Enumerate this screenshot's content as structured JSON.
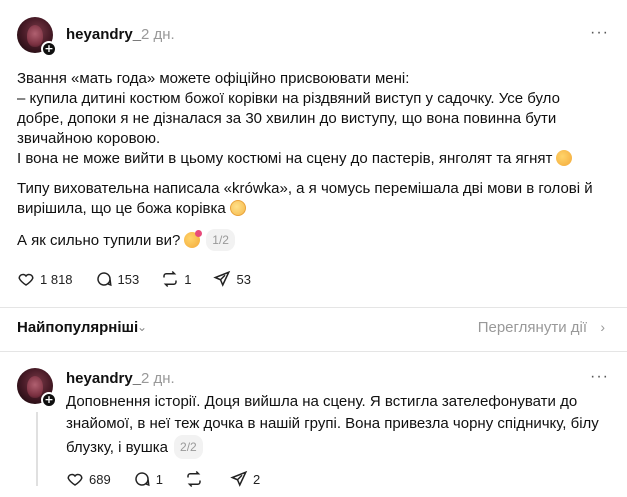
{
  "post": {
    "username": "heyandry_",
    "time": "2 дн.",
    "paragraphs": [
      "Звання «мать года» можете офіційно присвоювати мені:",
      "– купила дитині костюм божої корівки на різдвяний виступ у садочку. Усе було",
      "добре, допоки я не дізналася за 30 хвилин до виступу, що вона повинна бути",
      "звичайною коровою.",
      "І вона не може вийти в цьому костюмі на сцену до пастерів, янголят та ягнят"
    ],
    "paragraph2": [
      "Типу виховательна написала «krówka», а я чомусь перемішала дві мови в голові й",
      "вирішила, що це божа корівка"
    ],
    "question": "А як сильно тупили ви?",
    "pager": "1/2",
    "likes": "1 818",
    "comments": "153",
    "reposts": "1",
    "shares": "53"
  },
  "sort": {
    "label": "Найпопулярніші",
    "chevron": "⌄",
    "activity_link": "Переглянути дії",
    "activity_chevron": "›"
  },
  "reply": {
    "username": "heyandry_",
    "time": "2 дн.",
    "lines": [
      "Доповнення історії. Доця вийшла на сцену. Я встигла зателефонувати до",
      "знайомої, в неї теж дочка в нашій групі. Вона привезла чорну спідничку, білу",
      "блузку, і вушка"
    ],
    "pager": "2/2",
    "likes": "689",
    "comments": "1",
    "shares": "2"
  },
  "icons": {
    "more": "more-icon",
    "like": "heart-icon",
    "comment": "comment-icon",
    "repost": "repost-icon",
    "share": "share-icon",
    "follow": "plus-icon"
  }
}
